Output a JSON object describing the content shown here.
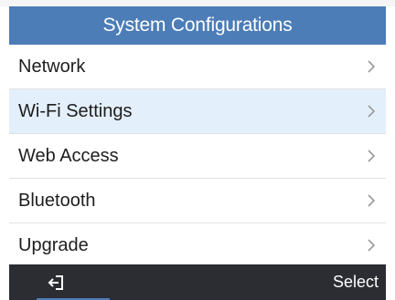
{
  "header": {
    "title": "System Configurations"
  },
  "menu": {
    "items": [
      {
        "label": "Network",
        "selected": false
      },
      {
        "label": "Wi-Fi Settings",
        "selected": true
      },
      {
        "label": "Web Access",
        "selected": false
      },
      {
        "label": "Bluetooth",
        "selected": false
      },
      {
        "label": "Upgrade",
        "selected": false
      }
    ]
  },
  "softkeys": {
    "left_icon": "exit-icon",
    "right_label": "Select"
  },
  "colors": {
    "title_bar": "#4c7db7",
    "selected_row": "#e3effa",
    "softkey_bar": "#2b2d33",
    "chevron": "#9a9a9a"
  }
}
